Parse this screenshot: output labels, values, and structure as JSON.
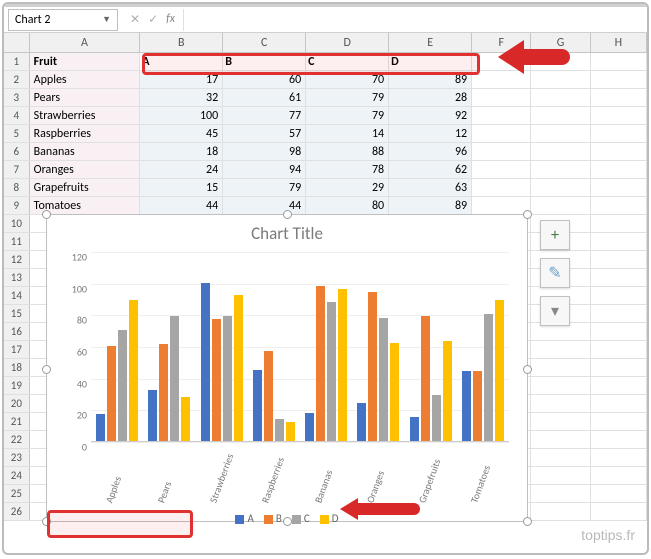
{
  "formula_bar": {
    "namebox": "Chart 2",
    "fx": "fx"
  },
  "columns": [
    "A",
    "B",
    "C",
    "D",
    "E",
    "F",
    "G",
    "H"
  ],
  "row_headers": [
    "1",
    "2",
    "3",
    "4",
    "5",
    "6",
    "7",
    "8",
    "9",
    "10",
    "11",
    "12",
    "13",
    "14",
    "15",
    "16",
    "17",
    "18",
    "19",
    "20",
    "21",
    "22",
    "23",
    "24",
    "25",
    "26"
  ],
  "table": {
    "header": {
      "fruit": "Fruit",
      "A": "A",
      "B": "B",
      "C": "C",
      "D": "D"
    },
    "rows": [
      {
        "fruit": "Apples",
        "A": 17,
        "B": 60,
        "C": 70,
        "D": 89
      },
      {
        "fruit": "Pears",
        "A": 32,
        "B": 61,
        "C": 79,
        "D": 28
      },
      {
        "fruit": "Strawberries",
        "A": 100,
        "B": 77,
        "C": 79,
        "D": 92
      },
      {
        "fruit": "Raspberries",
        "A": 45,
        "B": 57,
        "C": 14,
        "D": 12
      },
      {
        "fruit": "Bananas",
        "A": 18,
        "B": 98,
        "C": 88,
        "D": 96
      },
      {
        "fruit": "Oranges",
        "A": 24,
        "B": 94,
        "C": 78,
        "D": 62
      },
      {
        "fruit": "Grapefruits",
        "A": 15,
        "B": 79,
        "C": 29,
        "D": 63
      },
      {
        "fruit": "Tomatoes",
        "A": 44,
        "B": 44,
        "C": 80,
        "D": 89
      }
    ]
  },
  "chart": {
    "title": "Chart Title",
    "legend": [
      "A",
      "B",
      "C",
      "D"
    ],
    "yticks": [
      0,
      20,
      40,
      60,
      80,
      100,
      120
    ]
  },
  "chart_data": {
    "type": "bar",
    "title": "Chart Title",
    "xlabel": "",
    "ylabel": "",
    "ylim": [
      0,
      120
    ],
    "categories": [
      "Apples",
      "Pears",
      "Strawberries",
      "Raspberries",
      "Bananas",
      "Oranges",
      "Grapefruits",
      "Tomatoes"
    ],
    "series": [
      {
        "name": "A",
        "color": "#4472c4",
        "values": [
          17,
          32,
          100,
          45,
          18,
          24,
          15,
          44
        ]
      },
      {
        "name": "B",
        "color": "#ed7d31",
        "values": [
          60,
          61,
          77,
          57,
          98,
          94,
          79,
          44
        ]
      },
      {
        "name": "C",
        "color": "#a5a5a5",
        "values": [
          70,
          79,
          79,
          14,
          88,
          78,
          29,
          80
        ]
      },
      {
        "name": "D",
        "color": "#ffc000",
        "values": [
          89,
          28,
          92,
          12,
          96,
          62,
          63,
          89
        ]
      }
    ]
  },
  "colors": {
    "seriesA": "#4472c4",
    "seriesB": "#ed7d31",
    "seriesC": "#a5a5a5",
    "seriesD": "#ffc000",
    "highlight": "#e03030"
  },
  "watermark": "toptips.fr",
  "side_buttons": {
    "add": "+",
    "brush": "✎",
    "filter": "▾"
  }
}
